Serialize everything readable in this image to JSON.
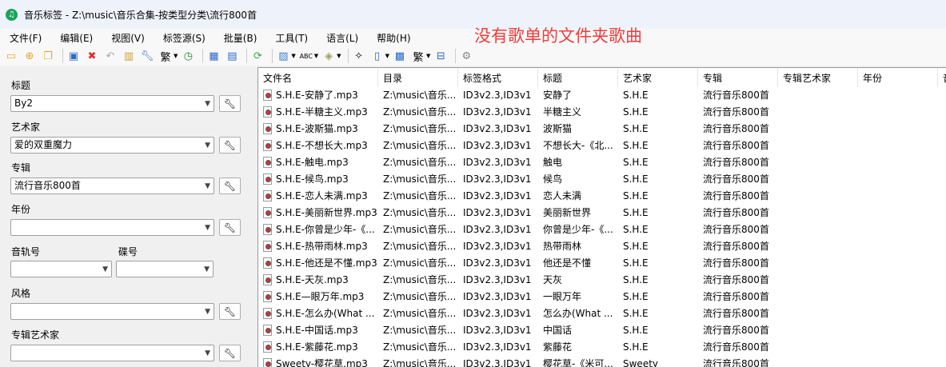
{
  "window": {
    "title": "音乐标签 - Z:\\music\\音乐合集-按类型分类\\流行800首",
    "icon": "music-note-icon"
  },
  "menu": [
    "文件(F)",
    "编辑(E)",
    "视图(V)",
    "标签源(S)",
    "批量(B)",
    "工具(T)",
    "语言(L)",
    "帮助(H)"
  ],
  "annotation": "没有歌单的文件夹歌曲",
  "fields": {
    "title": {
      "label": "标题",
      "value": "By2"
    },
    "artist": {
      "label": "艺术家",
      "value": "爱的双重魔力"
    },
    "album": {
      "label": "专辑",
      "value": "流行音乐800首"
    },
    "year": {
      "label": "年份",
      "value": ""
    },
    "track": {
      "label": "音轨号",
      "value": ""
    },
    "disc": {
      "label": "碟号",
      "value": ""
    },
    "genre": {
      "label": "风格",
      "value": ""
    },
    "album_artist": {
      "label": "专辑艺术家",
      "value": ""
    }
  },
  "columns": [
    "文件名",
    "目录",
    "标签格式",
    "标题",
    "艺术家",
    "专辑",
    "专辑艺术家",
    "年份",
    "音"
  ],
  "rows": [
    [
      "S.H.E-安静了.mp3",
      "Z:\\music\\音乐...",
      "ID3v2.3,ID3v1",
      "安静了",
      "S.H.E",
      "流行音乐800首"
    ],
    [
      "S.H.E-半糖主义.mp3",
      "Z:\\music\\音乐...",
      "ID3v2.3,ID3v1",
      "半糖主义",
      "S.H.E",
      "流行音乐800首"
    ],
    [
      "S.H.E-波斯猫.mp3",
      "Z:\\music\\音乐...",
      "ID3v2.3,ID3v1",
      "波斯猫",
      "S.H.E",
      "流行音乐800首"
    ],
    [
      "S.H.E-不想长大.mp3",
      "Z:\\music\\音乐...",
      "ID3v2.3,ID3v1",
      "不想长大-《北...",
      "S.H.E",
      "流行音乐800首"
    ],
    [
      "S.H.E-触电.mp3",
      "Z:\\music\\音乐...",
      "ID3v2.3,ID3v1",
      "触电",
      "S.H.E",
      "流行音乐800首"
    ],
    [
      "S.H.E-候鸟.mp3",
      "Z:\\music\\音乐...",
      "ID3v2.3,ID3v1",
      "候鸟",
      "S.H.E",
      "流行音乐800首"
    ],
    [
      "S.H.E-恋人未满.mp3",
      "Z:\\music\\音乐...",
      "ID3v2.3,ID3v1",
      "恋人未满",
      "S.H.E",
      "流行音乐800首"
    ],
    [
      "S.H.E-美丽新世界.mp3",
      "Z:\\music\\音乐...",
      "ID3v2.3,ID3v1",
      "美丽新世界",
      "S.H.E",
      "流行音乐800首"
    ],
    [
      "S.H.E-你曾是少年-《...",
      "Z:\\music\\音乐...",
      "ID3v2.3,ID3v1",
      "你曾是少年-《...",
      "S.H.E",
      "流行音乐800首"
    ],
    [
      "S.H.E-热带雨林.mp3",
      "Z:\\music\\音乐...",
      "ID3v2.3,ID3v1",
      "热带雨林",
      "S.H.E",
      "流行音乐800首"
    ],
    [
      "S.H.E-他还是不懂.mp3",
      "Z:\\music\\音乐...",
      "ID3v2.3,ID3v1",
      "他还是不懂",
      "S.H.E",
      "流行音乐800首"
    ],
    [
      "S.H.E-天灰.mp3",
      "Z:\\music\\音乐...",
      "ID3v2.3,ID3v1",
      "天灰",
      "S.H.E",
      "流行音乐800首"
    ],
    [
      "S.H.E—眼万年.mp3",
      "Z:\\music\\音乐...",
      "ID3v2.3,ID3v1",
      "一眼万年",
      "S.H.E",
      "流行音乐800首"
    ],
    [
      "S.H.E-怎么办(What ...",
      "Z:\\music\\音乐...",
      "ID3v2.3,ID3v1",
      "怎么办(What ...",
      "S.H.E",
      "流行音乐800首"
    ],
    [
      "S.H.E-中国话.mp3",
      "Z:\\music\\音乐...",
      "ID3v2.3,ID3v1",
      "中国话",
      "S.H.E",
      "流行音乐800首"
    ],
    [
      "S.H.E-紫藤花.mp3",
      "Z:\\music\\音乐...",
      "ID3v2.3,ID3v1",
      "紫藤花",
      "S.H.E",
      "流行音乐800首"
    ],
    [
      "Sweety-樱花草.mp3",
      "Z:\\music\\音乐...",
      "ID3v2.3,ID3v1",
      "樱花草-《米可...",
      "Sweety",
      "流行音乐800首"
    ]
  ]
}
